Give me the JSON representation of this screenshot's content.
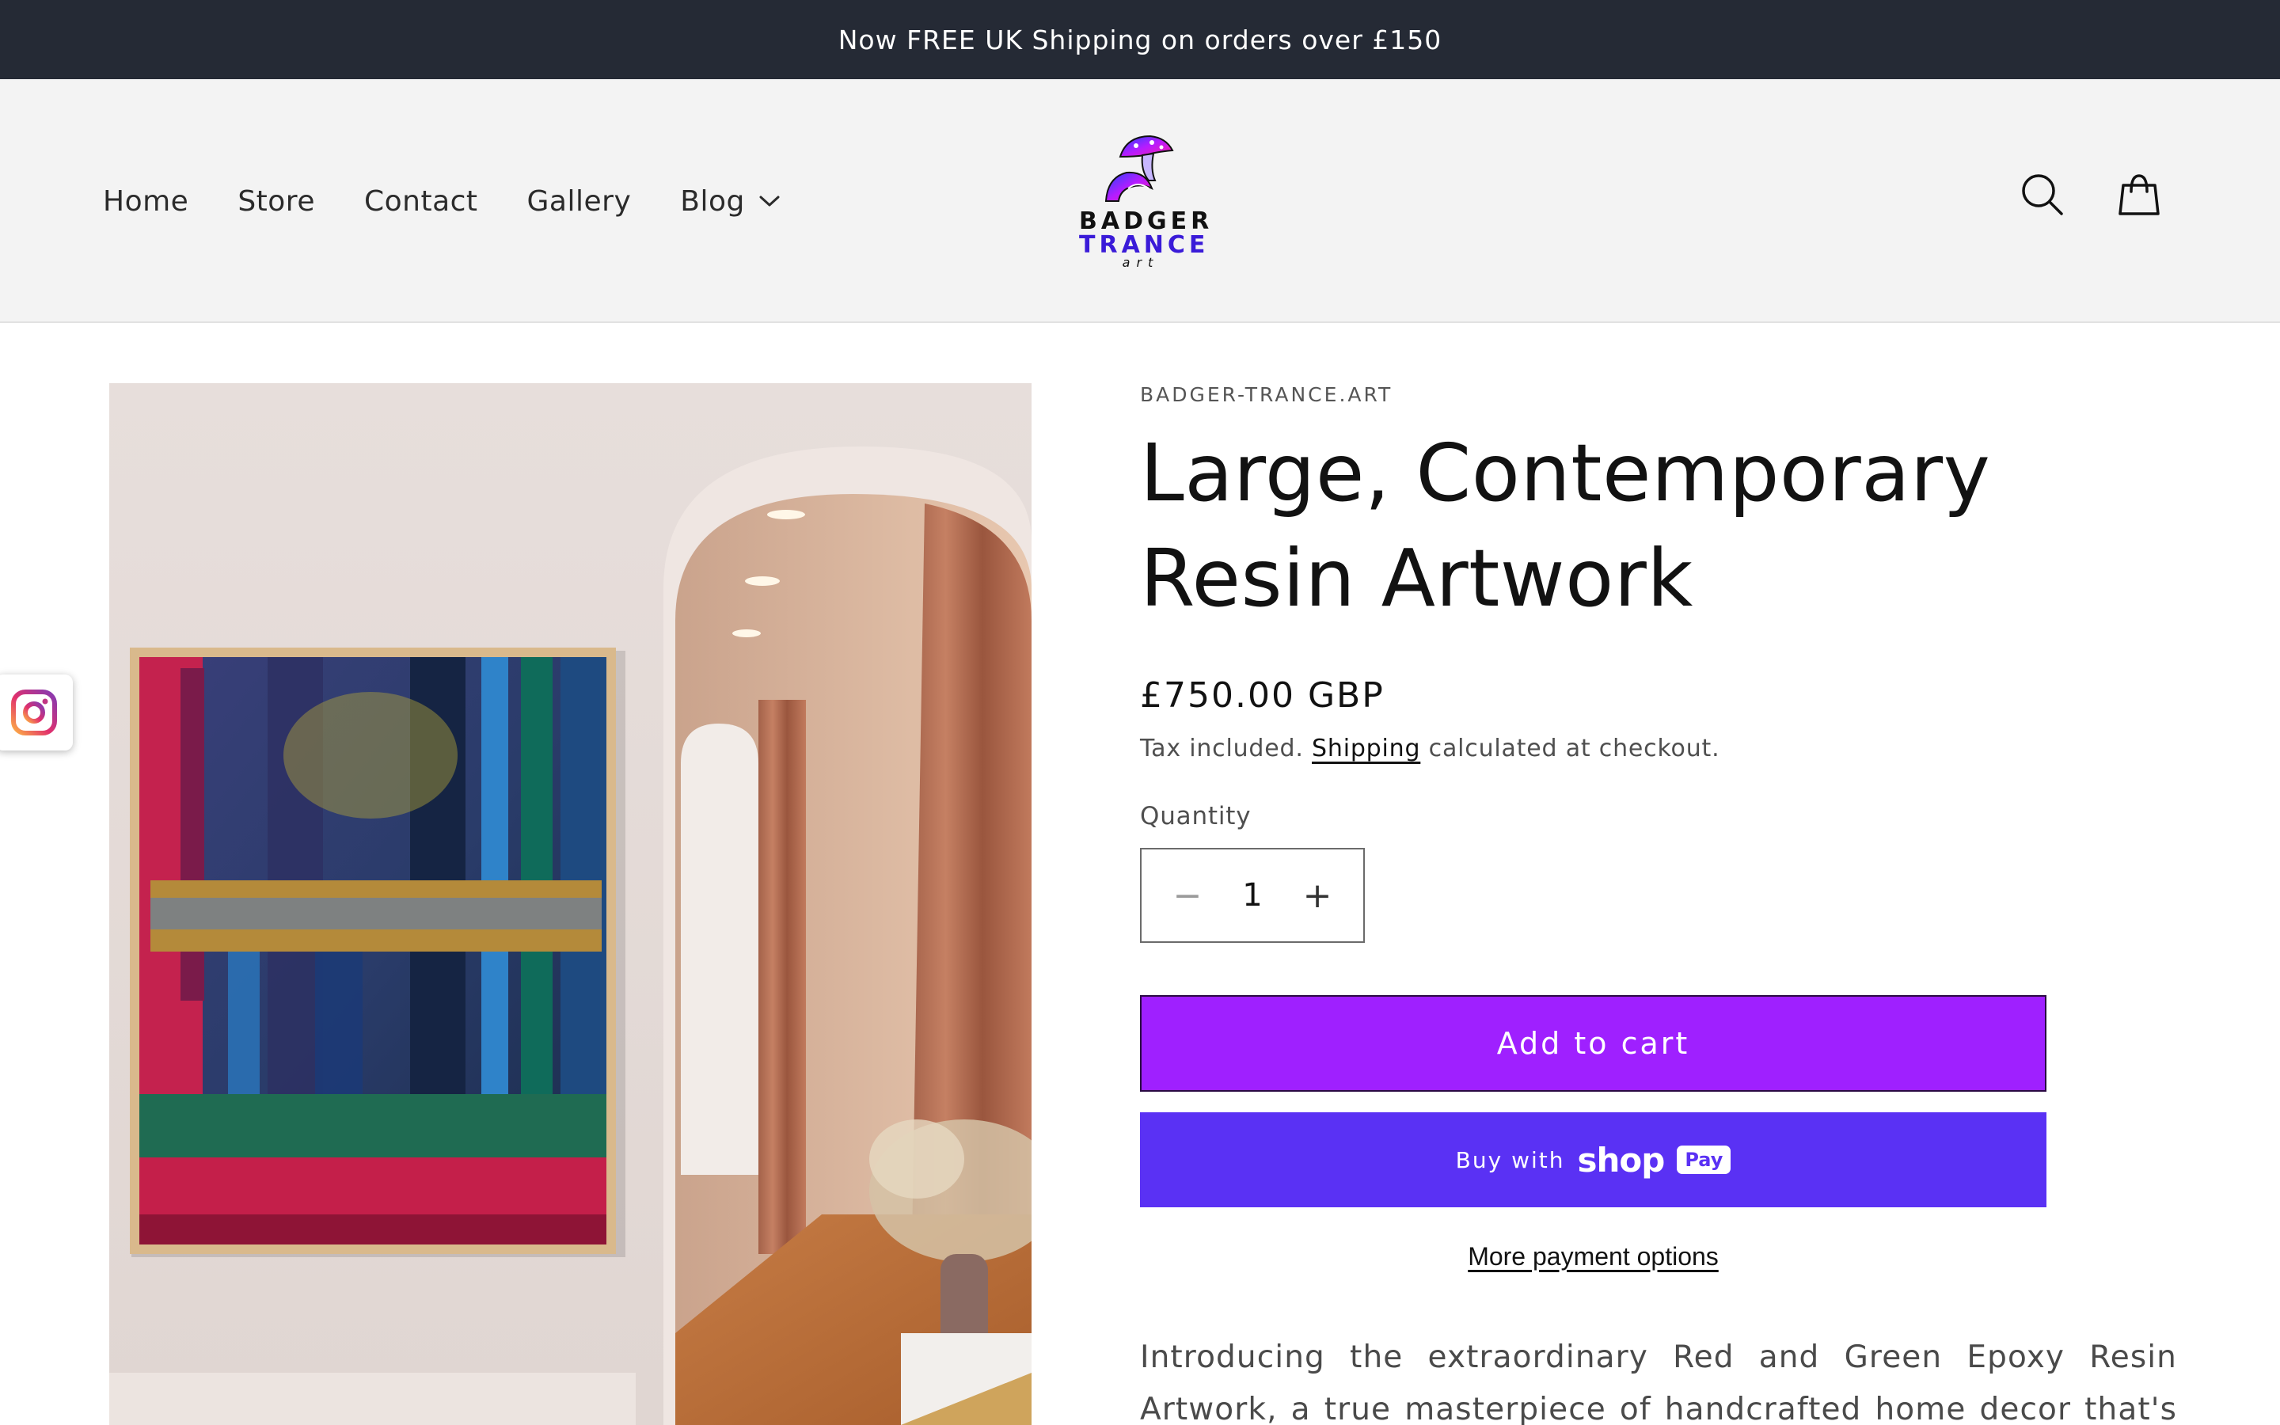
{
  "announcement": {
    "text": "Now FREE UK Shipping on orders over £150"
  },
  "header": {
    "nav": [
      {
        "label": "Home"
      },
      {
        "label": "Store"
      },
      {
        "label": "Contact"
      },
      {
        "label": "Gallery"
      },
      {
        "label": "Blog",
        "has_dropdown": true,
        "icon": "chevron-down-icon"
      }
    ],
    "logo": {
      "line1": "BADGER",
      "line2": "TRANCE",
      "line3": "art",
      "icon": "mushroom-logo-icon"
    },
    "icons": [
      "search-icon",
      "cart-icon"
    ]
  },
  "floating": {
    "icon": "instagram-icon"
  },
  "product": {
    "vendor": "BADGER-TRANCE.ART",
    "title": "Large, Contemporary Resin Artwork",
    "price": "£750.00 GBP",
    "tax_prefix": "Tax included. ",
    "tax_link": "Shipping",
    "tax_suffix": " calculated at checkout.",
    "quantity_label": "Quantity",
    "quantity_value": "1",
    "quantity_minus": "−",
    "quantity_plus": "+",
    "add_to_cart": "Add to cart",
    "shop_pay": {
      "prefix": "Buy with",
      "brand": "shop",
      "pill": "Pay"
    },
    "more_payment": "More payment options",
    "description": "Introducing the extraordinary Red and Green Epoxy Resin Artwork, a true masterpiece of handcrafted home decor that's bound to make a"
  },
  "colors": {
    "announcement_bg": "#252a35",
    "header_bg": "#f3f3f3",
    "add_to_cart_bg": "#9f20ff",
    "shop_pay_bg": "#5a31f4"
  }
}
